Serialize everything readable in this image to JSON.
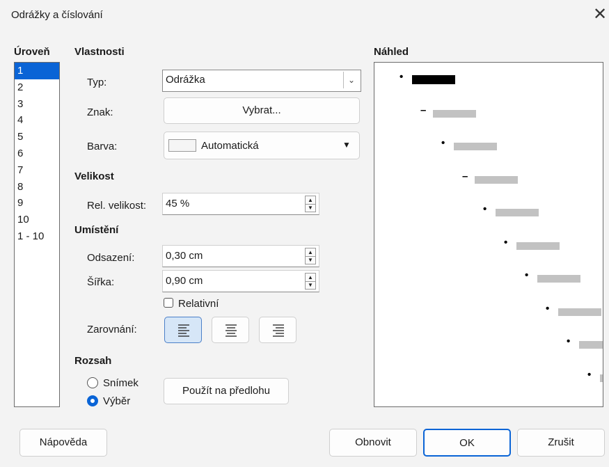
{
  "window": {
    "title": "Odrážky a číslování",
    "close_label": "✕"
  },
  "levels": {
    "header": "Úroveň",
    "items": [
      "1",
      "2",
      "3",
      "4",
      "5",
      "6",
      "7",
      "8",
      "9",
      "10",
      "1 - 10"
    ],
    "selected": "1"
  },
  "properties": {
    "header": "Vlastnosti",
    "type_label": "Typ:",
    "type_value": "Odrážka",
    "char_label": "Znak:",
    "choose_button": "Vybrat...",
    "color_label": "Barva:",
    "color_value": "Automatická"
  },
  "size": {
    "header": "Velikost",
    "rel_label": "Rel. velikost:",
    "rel_value": "45 %"
  },
  "position": {
    "header": "Umístění",
    "indent_label": "Odsazení:",
    "indent_value": "0,30 cm",
    "width_label": "Šířka:",
    "width_value": "0,90 cm",
    "relative_label": "Relativní",
    "relative_checked": false,
    "align_label": "Zarovnání:",
    "align_selected": "left"
  },
  "scope": {
    "header": "Rozsah",
    "slide_label": "Snímek",
    "selection_label": "Výběr",
    "selected": "selection",
    "apply_button": "Použít na předlohu"
  },
  "preview": {
    "header": "Náhled",
    "marks": [
      "•",
      "–",
      "•",
      "–",
      "•",
      "•",
      "•",
      "•",
      "•",
      "•"
    ]
  },
  "buttons": {
    "help": "Nápověda",
    "reset": "Obnovit",
    "ok": "OK",
    "cancel": "Zrušit"
  },
  "colors": {
    "accent": "#0a64d6",
    "preview_line": "#c2c2c2"
  }
}
